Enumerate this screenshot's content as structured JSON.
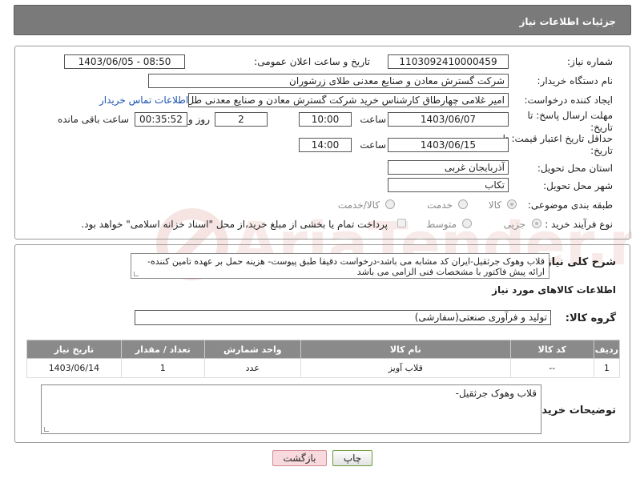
{
  "header": {
    "title": "جزئیات اطلاعات نیاز"
  },
  "fields": {
    "need_number_label": "شماره نیاز:",
    "need_number": "1103092410000459",
    "announce_label": "تاریخ و ساعت اعلان عمومی:",
    "announce_value": "1403/06/05 - 08:50",
    "buyer_org_label": "نام دستگاه خریدار:",
    "buyer_org": "شرکت گسترش معادن و صنایع معدنی طلای زرشوران",
    "creator_label": "ایجاد کننده درخواست:",
    "creator": "امیر  غلامی چهارطاق کارشناس خرید شرکت گسترش معادن و صنایع معدنی طل",
    "contact_link": "اطلاعات تماس خریدار",
    "deadline_label_1": "مهلت ارسال پاسخ: تا",
    "deadline_label_2": "تاریخ:",
    "deadline_date": "1403/06/07",
    "time_label": "ساعت",
    "deadline_time": "10:00",
    "days_value": "2",
    "days_label": "روز و",
    "remaining_time": "00:35:52",
    "remaining_label": "ساعت باقی مانده",
    "validity_label_1": "حداقل تاریخ اعتبار قیمت: تا",
    "validity_label_2": "تاریخ:",
    "validity_date": "1403/06/15",
    "validity_time": "14:00",
    "province_label": "استان محل تحویل:",
    "province": "آذربایجان غربی",
    "city_label": "شهر محل تحویل:",
    "city": "تکاب",
    "category_label": "طبقه بندی موضوعی:",
    "category_options": [
      "کالا",
      "خدمت",
      "کالا/خدمت"
    ],
    "process_label": "نوع فرآیند خرید :",
    "process_options": [
      "جزیی",
      "متوسط"
    ],
    "treasury_note": "پرداخت تمام یا بخشی از مبلغ خرید،از محل \"اسناد خزانه اسلامی\" خواهد بود."
  },
  "description": {
    "label": "شرح کلی نیاز:",
    "text": "قلاب وهوک جرثقیل-ایران کد مشابه می باشد-درخواست دقیقا طبق پیوست- هزینه حمل بر عهده تامین کننده- ارائه پیش فاکتور با مشخصات فنی الزامی می باشد"
  },
  "goods": {
    "section_title": "اطلاعات کالاهای مورد نیاز",
    "group_label": "گروه کالا:",
    "group_value": "تولید و فرآوری صنعتی(سفارشی)",
    "columns": [
      "ردیف",
      "کد کالا",
      "نام کالا",
      "واحد شمارش",
      "تعداد / مقدار",
      "تاریخ نیاز"
    ],
    "rows": [
      [
        "1",
        "--",
        "قلاب آویز",
        "عدد",
        "1",
        "1403/06/14"
      ]
    ]
  },
  "buyer_notes": {
    "label": "توضیحات خریدار:",
    "text": "قلاب وهوک جرثقیل-"
  },
  "buttons": {
    "print": "چاپ",
    "back": "بازگشت"
  }
}
